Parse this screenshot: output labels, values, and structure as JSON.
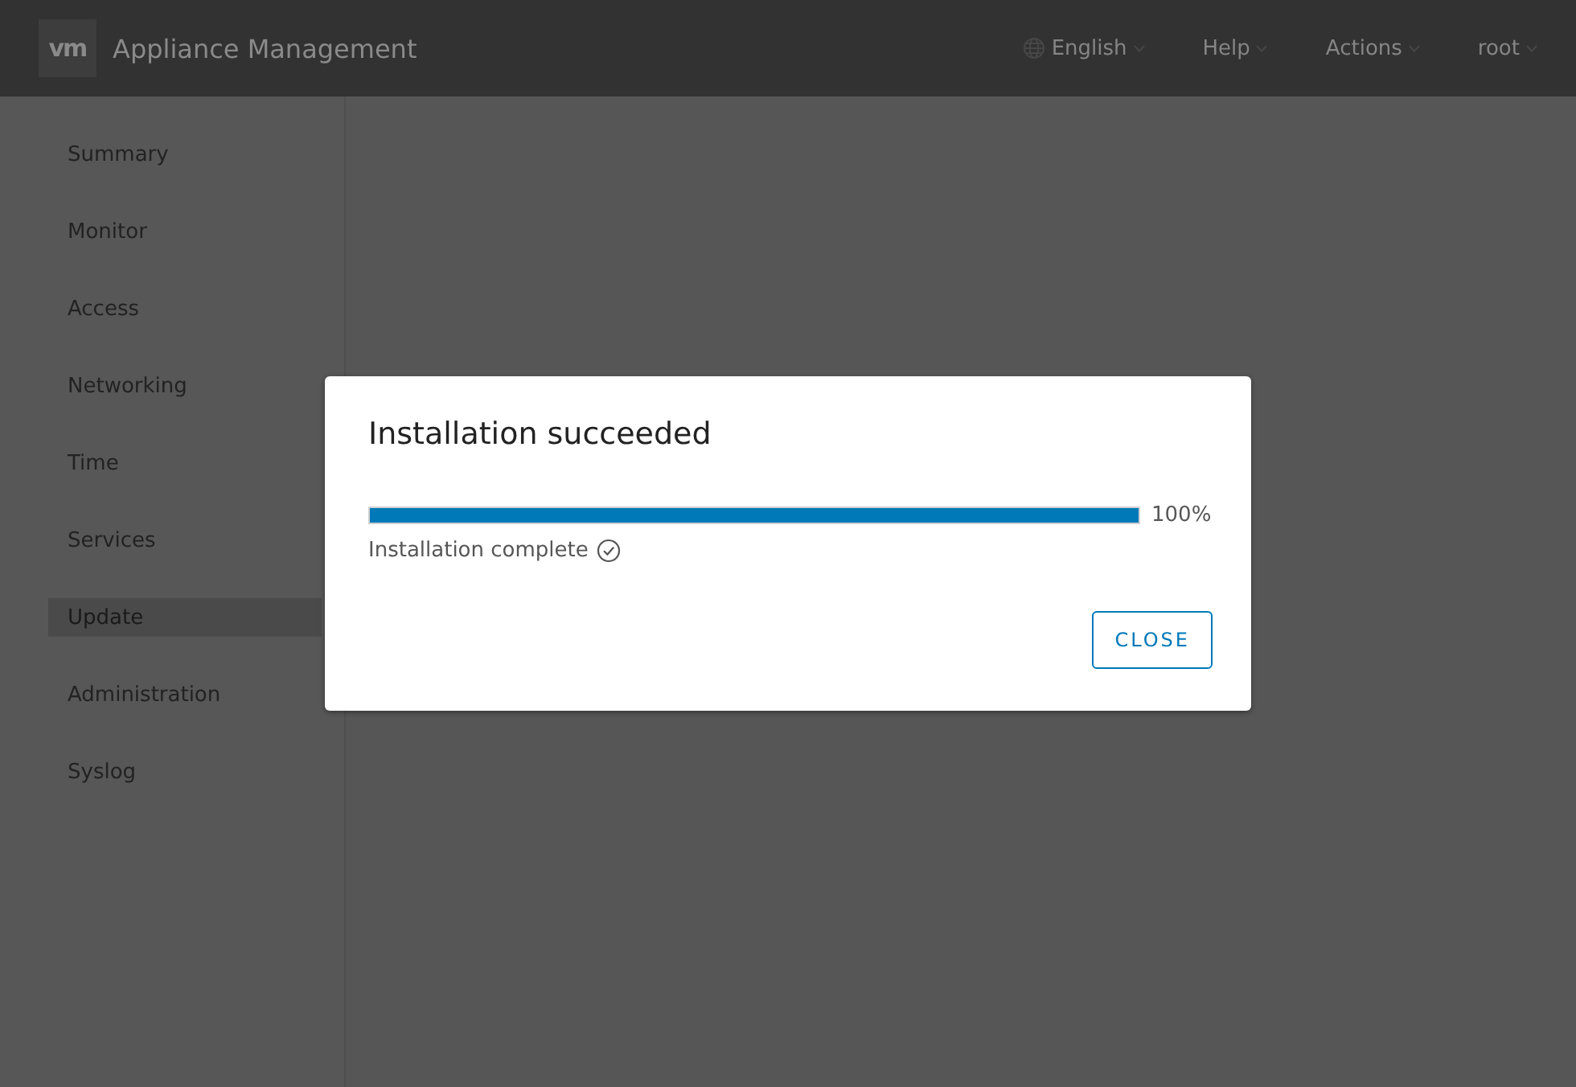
{
  "header": {
    "logo": "vm",
    "title": "Appliance Management",
    "menus": [
      {
        "label": "English",
        "kind": "language"
      },
      {
        "label": "Help",
        "kind": "menu"
      },
      {
        "label": "Actions",
        "kind": "menu"
      },
      {
        "label": "root",
        "kind": "menu"
      }
    ]
  },
  "sidebar": {
    "items": [
      {
        "label": "Summary",
        "selected": false
      },
      {
        "label": "Monitor",
        "selected": false
      },
      {
        "label": "Access",
        "selected": false
      },
      {
        "label": "Networking",
        "selected": false
      },
      {
        "label": "Time",
        "selected": false
      },
      {
        "label": "Services",
        "selected": false
      },
      {
        "label": "Update",
        "selected": true
      },
      {
        "label": "Administration",
        "selected": false
      },
      {
        "label": "Syslog",
        "selected": false
      }
    ]
  },
  "dialog": {
    "title": "Installation succeeded",
    "progress": {
      "level": 1,
      "reading": "100%"
    },
    "status": "Installation complete",
    "buttons": [
      "CLOSE"
    ]
  }
}
